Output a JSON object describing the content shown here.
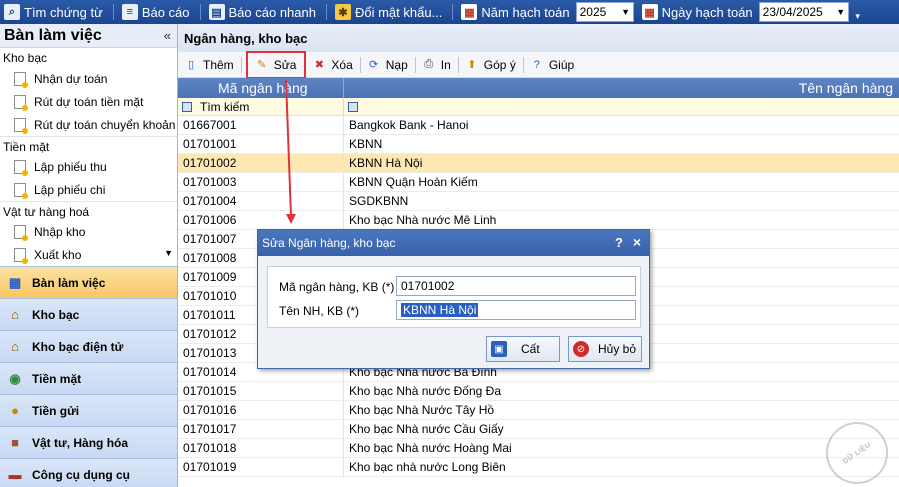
{
  "topbar": {
    "items": [
      {
        "label": "Tìm chứng từ",
        "icon": "search-icon"
      },
      {
        "label": "Báo cáo",
        "icon": "report-icon"
      },
      {
        "label": "Báo cáo nhanh",
        "icon": "quick-report-icon"
      },
      {
        "label": "Đổi mật khẩu...",
        "icon": "key-icon"
      }
    ],
    "year_label": "Năm hạch toán",
    "year_value": "2025",
    "date_label": "Ngày hạch toán",
    "date_value": "23/04/2025"
  },
  "left_panel": {
    "title": "Bàn làm việc",
    "collapse_glyph": "«",
    "groups": [
      {
        "title": "Kho bạc",
        "items": [
          "Nhận dự toán",
          "Rút dự toán tiền mặt",
          "Rút dự toán chuyển khoản"
        ]
      },
      {
        "title": "Tiền mặt",
        "items": [
          "Lập phiếu thu",
          "Lập phiếu chi"
        ]
      },
      {
        "title": "Vật tư hàng hoá",
        "items": [
          "Nhập kho",
          "Xuất kho"
        ]
      }
    ],
    "nav": [
      {
        "label": "Bàn làm việc",
        "icon": "desk-icon",
        "active": true
      },
      {
        "label": "Kho bạc",
        "icon": "treasury-icon"
      },
      {
        "label": "Kho bạc điện tử",
        "icon": "e-treasury-icon"
      },
      {
        "label": "Tiền mặt",
        "icon": "cash-icon"
      },
      {
        "label": "Tiền gửi",
        "icon": "deposit-icon"
      },
      {
        "label": "Vật tư, Hàng hóa",
        "icon": "goods-icon"
      },
      {
        "label": "Công cụ dụng cụ",
        "icon": "tools-icon"
      }
    ]
  },
  "main": {
    "title": "Ngân hàng, kho bạc",
    "toolbar": {
      "add": "Thêm",
      "edit": "Sửa",
      "delete": "Xóa",
      "reload": "Nạp",
      "print": "In",
      "feedback": "Góp ý",
      "help": "Giúp"
    },
    "columns": [
      "Mã ngân hàng",
      "Tên ngân hàng"
    ],
    "filter_placeholder": "Tìm kiếm",
    "rows": [
      {
        "code": "01667001",
        "name": "Bangkok Bank - Hanoi"
      },
      {
        "code": "01701001",
        "name": "KBNN"
      },
      {
        "code": "01701002",
        "name": "KBNN Hà Nội",
        "selected": true
      },
      {
        "code": "01701003",
        "name": "KBNN Quận Hoàn Kiếm"
      },
      {
        "code": "01701004",
        "name": "SGDKBNN"
      },
      {
        "code": "01701006",
        "name": "Kho bạc Nhà nước Mê Linh"
      },
      {
        "code": "01701007",
        "name": ""
      },
      {
        "code": "01701008",
        "name": ""
      },
      {
        "code": "01701009",
        "name": ""
      },
      {
        "code": "01701010",
        "name": ""
      },
      {
        "code": "01701011",
        "name": ""
      },
      {
        "code": "01701012",
        "name": ""
      },
      {
        "code": "01701013",
        "name": ""
      },
      {
        "code": "01701014",
        "name": "Kho bạc Nhà nước Ba Đình"
      },
      {
        "code": "01701015",
        "name": "Kho bạc Nhà nước Đống Đa"
      },
      {
        "code": "01701016",
        "name": "Kho bạc Nhà Nước Tây Hồ"
      },
      {
        "code": "01701017",
        "name": "Kho bạc Nhà nước Cầu Giấy"
      },
      {
        "code": "01701018",
        "name": "Kho bạc Nhà nước Hoàng Mai"
      },
      {
        "code": "01701019",
        "name": "Kho bạc nhà nước Long Biên"
      }
    ]
  },
  "dialog": {
    "title": "Sửa Ngân hàng, kho bạc",
    "help_glyph": "?",
    "close_glyph": "×",
    "code_label": "Mã ngân hàng, KB (*)",
    "code_value": "01701002",
    "name_label": "Tên NH, KB (*)",
    "name_value": "KBNN Hà Nội",
    "save_label": "Cất",
    "cancel_label": "Hủy bỏ"
  },
  "colors": {
    "accent": "#1b4590",
    "highlight": "#e0313d",
    "selected_row": "#fde8b4"
  }
}
